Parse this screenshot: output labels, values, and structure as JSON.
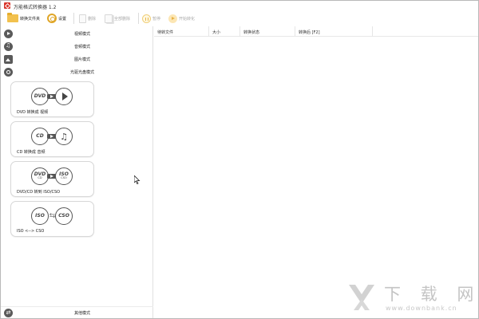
{
  "window": {
    "title": "万能格式转换器 1.2"
  },
  "toolbar": {
    "add_folder_label": "转换文件夹",
    "settings_label": "设置",
    "delete_label": "删除",
    "delete_all_label": "全部删除",
    "pause_label": "暂停",
    "start_label": "开始转化"
  },
  "sidebar": {
    "modes": [
      {
        "label": "视频模式",
        "icon": "video-icon"
      },
      {
        "label": "音频模式",
        "icon": "audio-icon"
      },
      {
        "label": "图片模式",
        "icon": "image-icon"
      },
      {
        "label": "光驱光盘模式",
        "icon": "disc-icon"
      }
    ],
    "cards": [
      {
        "label": "DVD 转换成 视频",
        "from": "DVD",
        "to_icon": "play-icon"
      },
      {
        "label": "CD 转换成 音频",
        "from": "CD",
        "to_icon": "music-note-icon"
      },
      {
        "label": "DVD/CD 转到 ISO/CSO",
        "from": "DVD",
        "from_sub": "CD",
        "to": "ISO",
        "to_sub": "CSO"
      },
      {
        "label": "ISO <--> CSO",
        "from": "ISO",
        "to": "CSO"
      }
    ],
    "other_label": "其他模式"
  },
  "file_list": {
    "columns": [
      "待转文件",
      "大小",
      "转换状态",
      "转换后 [F2]"
    ],
    "rows": []
  },
  "watermark": {
    "brand": "下 载 网",
    "url": "www.downbank.cn"
  },
  "colors": {
    "app_icon": "#d9362b",
    "accent": "#e0a628",
    "watermark": "#c4c4c4"
  }
}
